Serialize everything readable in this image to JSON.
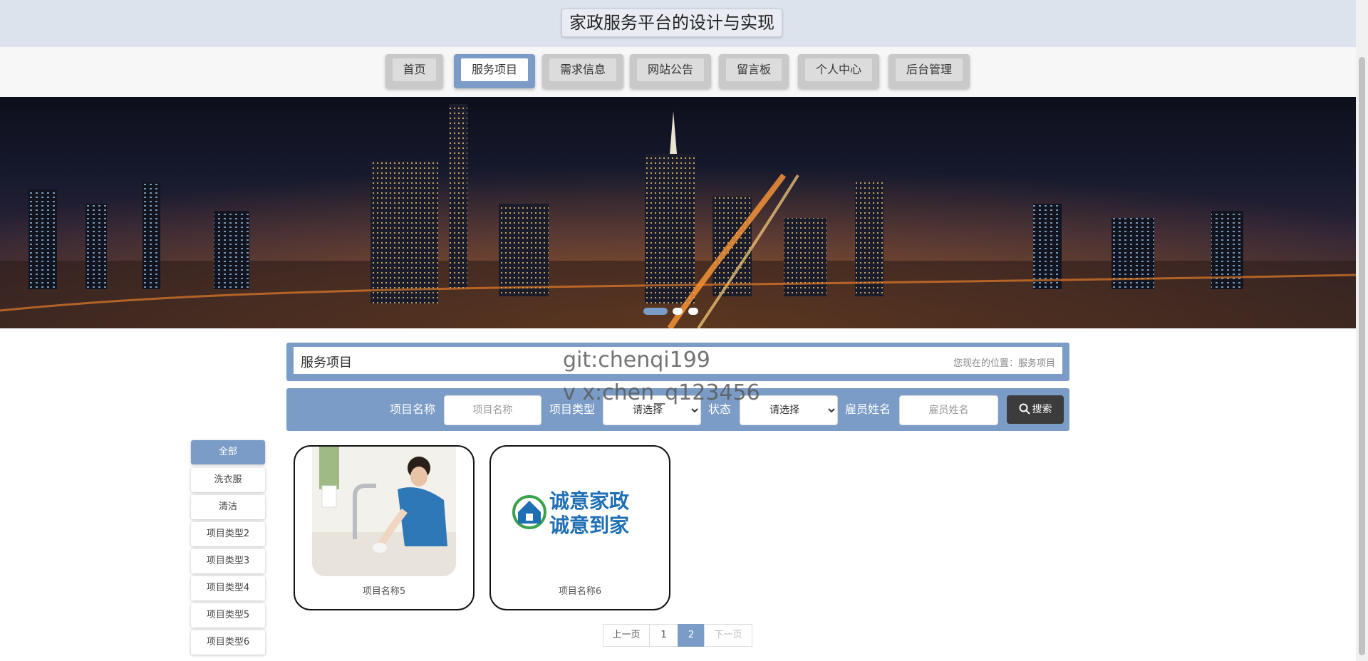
{
  "header": {
    "title": "家政服务平台的设计与实现"
  },
  "nav": {
    "items": [
      {
        "label": "首页"
      },
      {
        "label": "服务项目"
      },
      {
        "label": "需求信息"
      },
      {
        "label": "网站公告"
      },
      {
        "label": "留言板"
      },
      {
        "label": "个人中心"
      },
      {
        "label": "后台管理"
      }
    ],
    "active_index": 1
  },
  "carousel": {
    "slide_count": 3,
    "active_index": 0
  },
  "section": {
    "title": "服务项目",
    "breadcrumb": "您现在的位置：服务项目"
  },
  "watermark": {
    "line1": "git:chenqi199",
    "line2": "v x:chen_q123456"
  },
  "search": {
    "name_label": "项目名称",
    "name_placeholder": "项目名称",
    "type_label": "项目类型",
    "type_selected": "请选择",
    "status_label": "状态",
    "status_selected": "请选择",
    "employee_label": "雇员姓名",
    "employee_placeholder": "雇员姓名",
    "button_label": "搜索"
  },
  "categories": {
    "items": [
      {
        "label": "全部"
      },
      {
        "label": "洗衣服"
      },
      {
        "label": "清洁"
      },
      {
        "label": "项目类型2"
      },
      {
        "label": "项目类型3"
      },
      {
        "label": "项目类型4"
      },
      {
        "label": "项目类型5"
      },
      {
        "label": "项目类型6"
      }
    ],
    "active_index": 0
  },
  "cards": [
    {
      "name": "项目名称5"
    },
    {
      "name": "项目名称6",
      "logo_line1": "诚意家政",
      "logo_line2": "诚意到家"
    }
  ],
  "pagination": {
    "prev": "上一页",
    "pages": [
      "1",
      "2"
    ],
    "current": "2",
    "next": "下一页"
  },
  "colors": {
    "accent": "#7b9cc7",
    "header_bg": "#dde3ec",
    "button_dark": "#3c3c3c",
    "logo_blue": "#1f6fb5",
    "logo_green": "#3aa24a"
  }
}
